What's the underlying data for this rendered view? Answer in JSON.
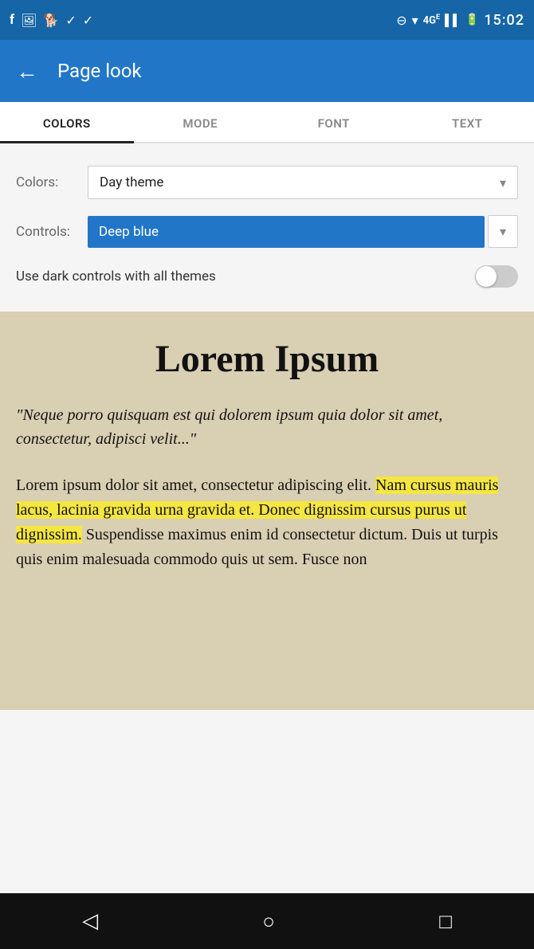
{
  "status_bar": {
    "time": "15:02",
    "icons_left": [
      "facebook-icon",
      "image-icon",
      "app-icon",
      "bookmark-icon",
      "check-icon"
    ],
    "icons_right": [
      "minus-circle-icon",
      "wifi-icon",
      "4g-icon",
      "signal-icon",
      "battery-icon"
    ]
  },
  "app_bar": {
    "back_label": "←",
    "title": "Page look"
  },
  "tabs": [
    {
      "label": "COLORS",
      "active": true
    },
    {
      "label": "MODE",
      "active": false
    },
    {
      "label": "FONT",
      "active": false
    },
    {
      "label": "TEXT",
      "active": false
    }
  ],
  "settings": {
    "colors_label": "Colors:",
    "colors_value": "Day theme",
    "controls_label": "Controls:",
    "controls_value": "Deep blue",
    "dark_controls_label": "Use dark controls with all themes"
  },
  "preview": {
    "title": "Lorem Ipsum",
    "quote": "\"Neque porro quisquam est qui dolorem ipsum quia dolor sit amet, consectetur, adipisci velit...\"",
    "body_before_highlight": "Lorem ipsum dolor sit amet, consectetur adipiscing elit. ",
    "highlight_text": "Nam cursus mauris lacus, lacinia gravida urna gravida et. Donec dignissim cursus purus ut dignissim.",
    "body_after_highlight": " Suspendisse maximus enim id consectetur dictum. Duis ut turpis quis enim malesuada commodo quis ut sem. Fusce non"
  },
  "nav_bar": {
    "back_icon": "◁",
    "home_icon": "○",
    "square_icon": "□"
  }
}
